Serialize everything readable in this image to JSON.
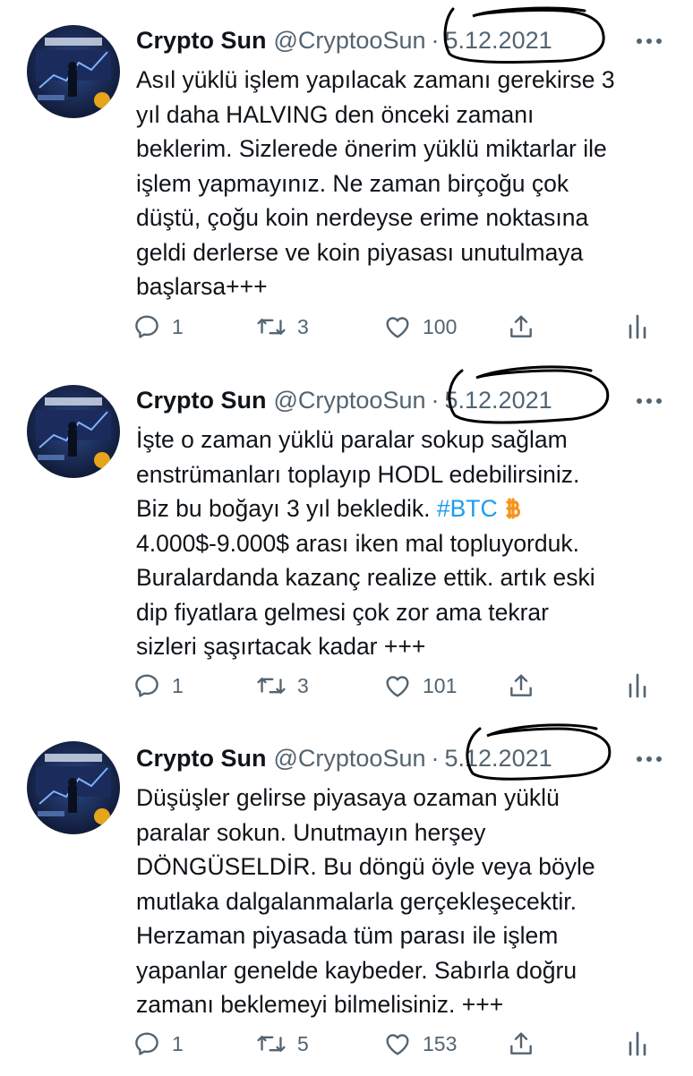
{
  "tweets": [
    {
      "name": "Crypto Sun",
      "handle": "@CryptooSun",
      "separator": "·",
      "date": "5.12.2021",
      "lines": [
        "Asıl yüklü işlem yapılacak zamanı gerekirse 3",
        "yıl daha HALVING den önceki zamanı",
        "beklerim. Sizlerede önerim yüklü miktarlar ile",
        "işlem yapmayınız. Ne zaman birçoğu çok",
        "düştü, çoğu koin nerdeyse erime noktasına",
        "geldi derlerse ve koin piyasası unutulmaya",
        "başlarsa+++"
      ],
      "replies": "1",
      "retweets": "3",
      "likes": "100"
    },
    {
      "name": "Crypto Sun",
      "handle": "@CryptooSun",
      "separator": "·",
      "date": "5.12.2021",
      "line1": "İşte o zaman yüklü paralar sokup sağlam",
      "line2": "enstrümanları toplayıp HODL edebilirsiniz.",
      "line3_text": "Biz bu boğayı 3 yıl bekledik. ",
      "line3_hashtag": "#BTC",
      "lines_rest": [
        "4.000$-9.000$ arası iken mal topluyorduk.",
        "Buralardanda kazanç realize ettik. artık eski",
        "dip fiyatlara gelmesi çok zor ama tekrar",
        "sizleri şaşırtacak kadar +++"
      ],
      "replies": "1",
      "retweets": "3",
      "likes": "101"
    },
    {
      "name": "Crypto Sun",
      "handle": "@CryptooSun",
      "separator": "·",
      "date": "5.12.2021",
      "lines": [
        "Düşüşler gelirse piyasaya ozaman yüklü",
        "paralar sokun. Unutmayın herşey",
        "DÖNGÜSELDİR. Bu döngü öyle veya böyle",
        "mutlaka dalgalanmalarla gerçekleşecektir.",
        "Herzaman piyasada tüm parası ile işlem",
        "yapanlar genelde kaybeder. Sabırla doğru",
        "zamanı beklemeyi bilmelisiniz. +++"
      ],
      "replies": "1",
      "retweets": "5",
      "likes": "153"
    }
  ],
  "colors": {
    "text": "#0f1419",
    "secondary": "#536471",
    "link": "#1d9bf0",
    "bitcoin": "#f7931a",
    "annotation": "#000000"
  },
  "icons": [
    "reply-icon",
    "retweet-icon",
    "like-icon",
    "share-icon",
    "analytics-icon",
    "more-icon",
    "bitcoin-icon"
  ]
}
